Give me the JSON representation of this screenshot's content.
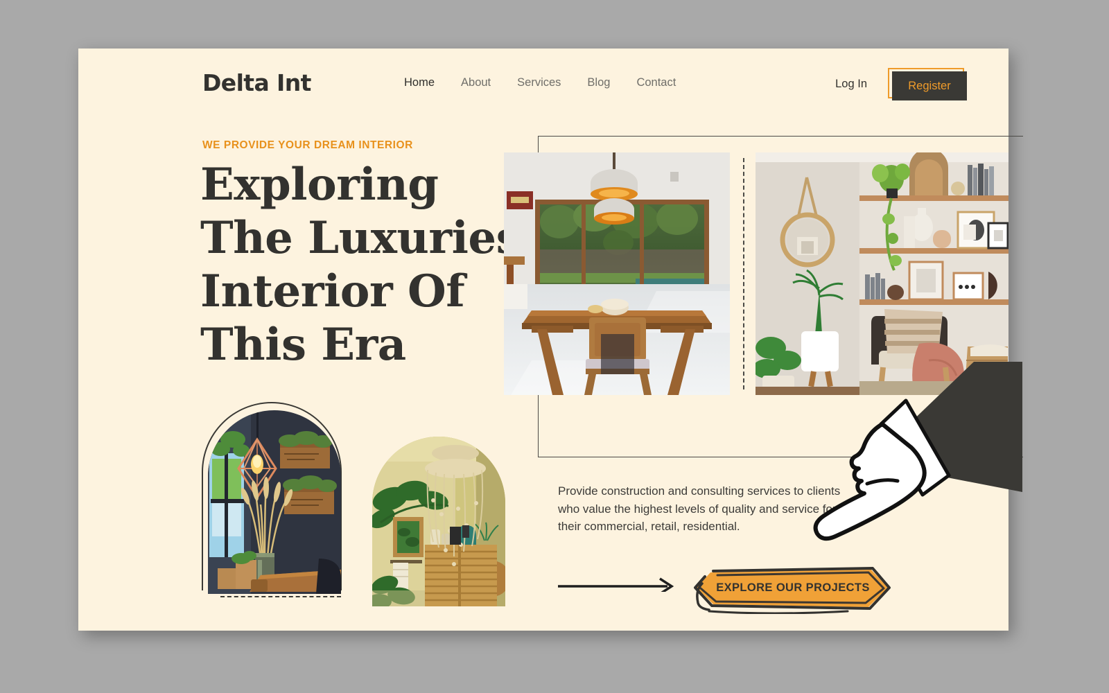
{
  "theme": {
    "page_bg": "#a9a9a9",
    "card_bg": "#fdf3df",
    "accent_orange": "#ef9b2a",
    "eyebrow_orange": "#e8911c",
    "ink": "#33322f",
    "muted_ink": "#6f6e69"
  },
  "header": {
    "logo": "Delta Int",
    "nav": [
      {
        "label": "Home",
        "active": true
      },
      {
        "label": "About",
        "active": false
      },
      {
        "label": "Services",
        "active": false
      },
      {
        "label": "Blog",
        "active": false
      },
      {
        "label": "Contact",
        "active": false
      }
    ],
    "login_label": "Log In",
    "register_label": "Register"
  },
  "hero": {
    "eyebrow": "WE PROVIDE YOUR DREAM INTERIOR",
    "headline_lines": [
      "Exploring",
      "The Luxuries",
      "Interior Of",
      "This Era"
    ],
    "photos": [
      {
        "name": "modern-dining-room",
        "alt": "Modern dining room with pendant lamps, wooden table and garden view"
      },
      {
        "name": "boho-living-corner",
        "alt": "Boho living corner with wall shelves, round mirror, plants and armchair"
      }
    ],
    "arch_photos": [
      {
        "name": "dark-nook-with-crates",
        "alt": "Dark wall nook with copper geometric pendant lamp, wooden wall crates and dried pampas grass"
      },
      {
        "name": "beaded-chandelier-corner",
        "alt": "Warm toned corner with beaded chandelier, framed art and bamboo screen"
      }
    ]
  },
  "intro": {
    "paragraph_lines": [
      "Provide construction and consulting services to clients",
      "who value the highest levels of quality and service for",
      "their commercial, retail,  residential."
    ],
    "cta_label": "EXPLORE OUR PROJECTS"
  },
  "decor": {
    "hand_alt": "Vintage pointing hand with suit sleeve indicating the call to action"
  }
}
